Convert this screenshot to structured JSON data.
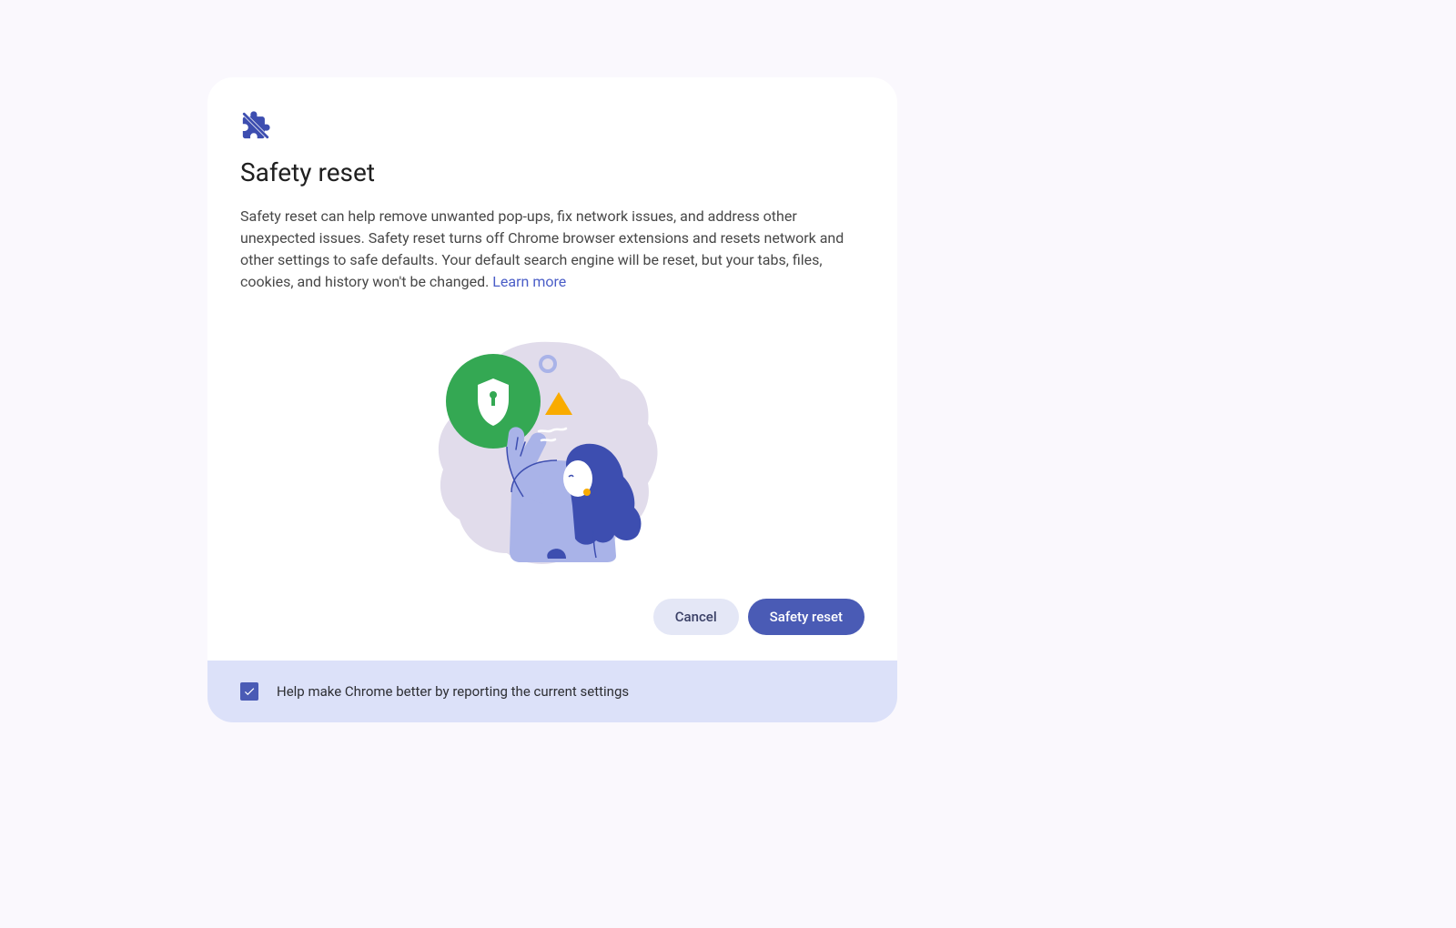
{
  "dialog": {
    "title": "Safety reset",
    "description": "Safety reset can help remove unwanted pop-ups, fix network issues, and address other unexpected issues. Safety reset turns off Chrome browser extensions and resets network and other settings to safe defaults. Your default search engine will be reset, but your tabs, files, cookies, and history won't be changed. ",
    "learn_more": "Learn more"
  },
  "buttons": {
    "cancel": "Cancel",
    "confirm": "Safety reset"
  },
  "footer": {
    "checkbox_label": "Help make Chrome better by reporting the current settings",
    "checked": true
  }
}
